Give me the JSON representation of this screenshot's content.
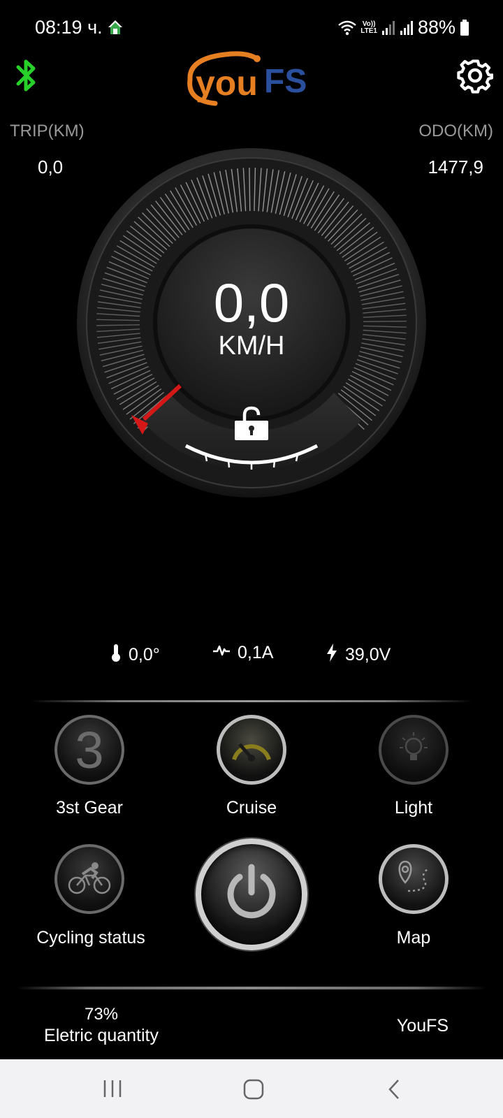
{
  "status_bar": {
    "time": "08:19 ч.",
    "volte_line1": "Vo))",
    "volte_line2": "LTE1",
    "battery": "88%"
  },
  "header": {
    "logo_part1": "you",
    "logo_part2": "FS",
    "bluetooth_color": "#28d02a",
    "logo_orange": "#e67e22",
    "logo_blue": "#2a4f9c"
  },
  "trip": {
    "label": "TRIP(KM)",
    "value": "0,0"
  },
  "odo": {
    "label": "ODO(KM)",
    "value": "1477,9"
  },
  "speed": {
    "value": "0,0",
    "unit": "KM/H"
  },
  "metrics": {
    "temperature": "0,0°",
    "current": "0,1A",
    "voltage": "39,0V"
  },
  "controls": {
    "gear": {
      "number": "3",
      "label": "3st Gear"
    },
    "cruise": {
      "label": "Cruise"
    },
    "light": {
      "label": "Light"
    },
    "cycling": {
      "label": "Cycling status"
    },
    "map": {
      "label": "Map"
    }
  },
  "footer": {
    "battery_percent": "73%",
    "battery_label": "Eletric quantity",
    "brand": "YouFS"
  }
}
